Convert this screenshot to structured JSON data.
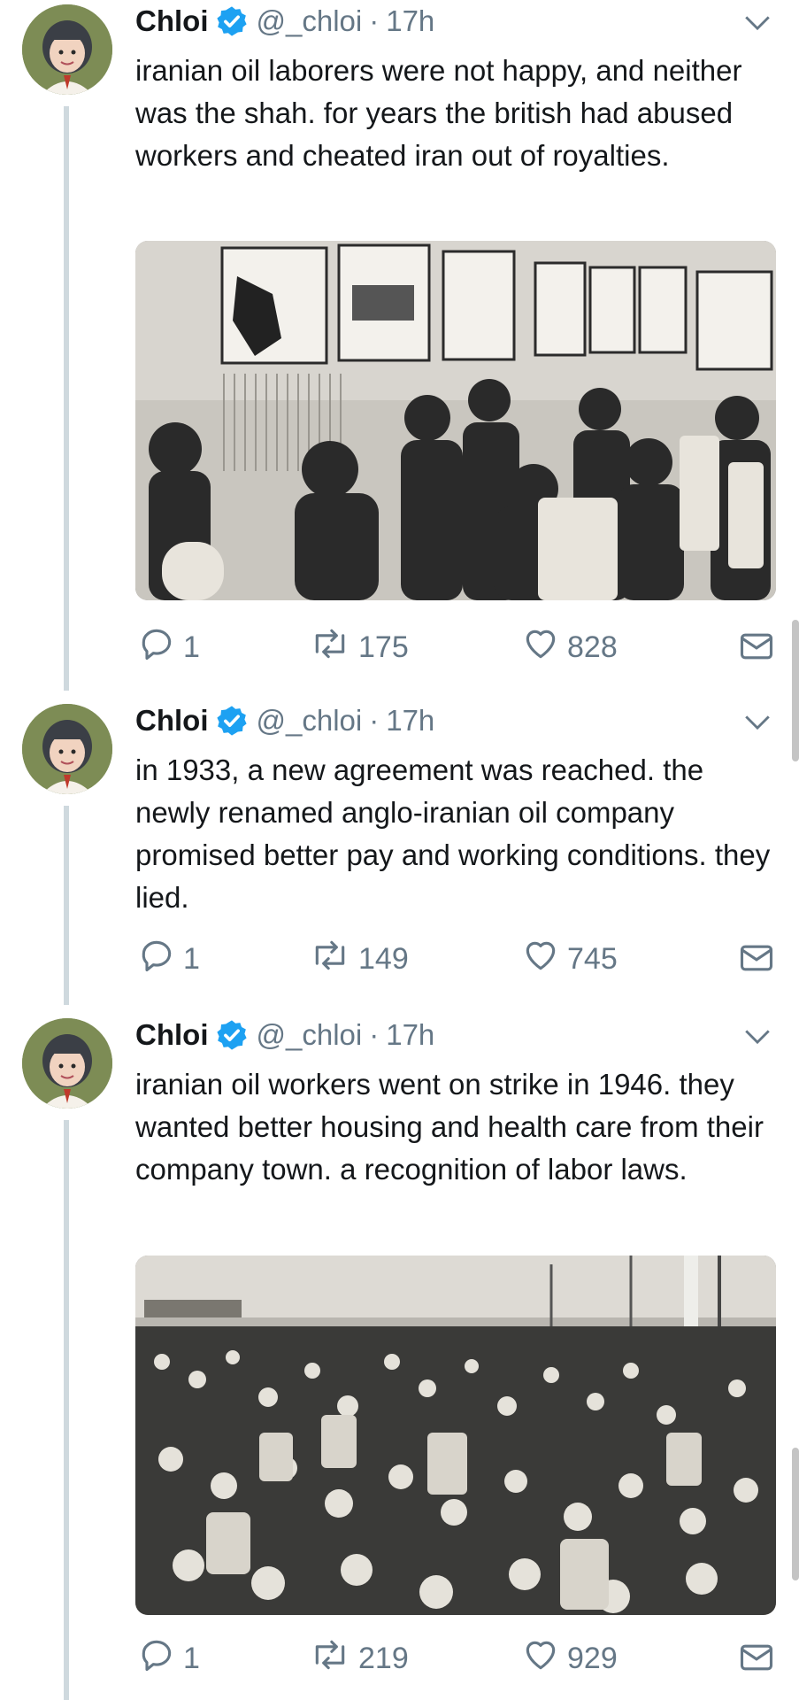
{
  "tweets": [
    {
      "name": "Chloi",
      "handle": "@_chloi",
      "separator": "·",
      "time": "17h",
      "text": "iranian oil laborers were not happy, and neither was the shah. for years the british had abused workers and cheated iran out of royalties.",
      "has_media": true,
      "media_description": "black-and-white photo of young workers at machinery stations",
      "replies": "1",
      "retweets": "175",
      "likes": "828"
    },
    {
      "name": "Chloi",
      "handle": "@_chloi",
      "separator": "·",
      "time": "17h",
      "text": "in 1933, a new agreement was reached. the newly renamed anglo-iranian oil company promised better pay and working conditions. they lied.",
      "has_media": false,
      "replies": "1",
      "retweets": "149",
      "likes": "745"
    },
    {
      "name": "Chloi",
      "handle": "@_chloi",
      "separator": "·",
      "time": "17h",
      "text": "iranian oil workers went on strike in 1946. they wanted better housing and health care from their company town. a recognition of labor laws.",
      "has_media": true,
      "media_description": "black-and-white photo of a large crowd of striking workers",
      "replies": "1",
      "retweets": "219",
      "likes": "929"
    }
  ],
  "colors": {
    "verified": "#1da1f2",
    "muted": "#657786",
    "text": "#14171a",
    "thread_line": "#cfd9de"
  },
  "icons": [
    "verified-badge-icon",
    "chevron-down-icon",
    "reply-icon",
    "retweet-icon",
    "like-icon",
    "direct-message-icon"
  ]
}
